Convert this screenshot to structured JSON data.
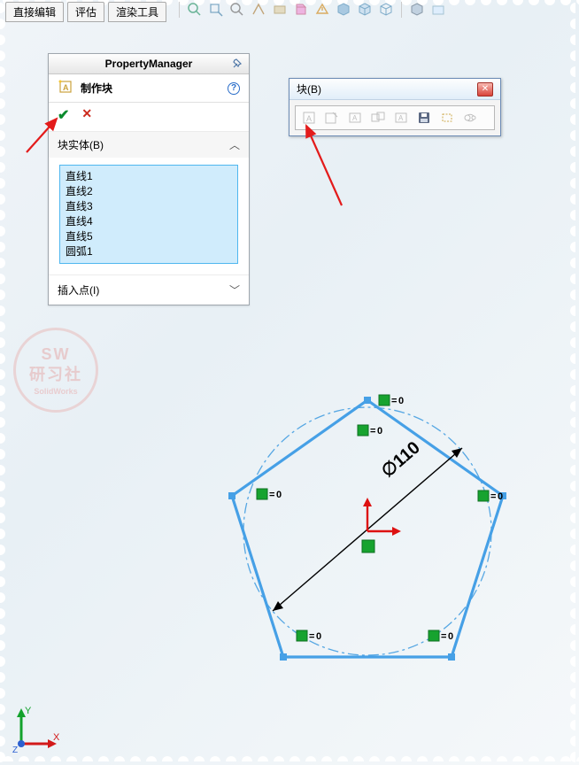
{
  "top_tabs": {
    "t1": "直接编辑",
    "t2": "评估",
    "t3": "渲染工具"
  },
  "pm": {
    "title": "PropertyManager",
    "head_label": "制作块",
    "sec1": "块实体(B)",
    "sec2": "插入点(I)",
    "items": [
      "直线1",
      "直线2",
      "直线3",
      "直线4",
      "直线5",
      "圆弧1"
    ]
  },
  "block_popup": {
    "title": "块(B)"
  },
  "dimension": {
    "label": "∅110"
  },
  "watermark": {
    "l1": "SW",
    "l2": "研习社",
    "l3": "SolidWorks"
  },
  "constraint_label": "0"
}
